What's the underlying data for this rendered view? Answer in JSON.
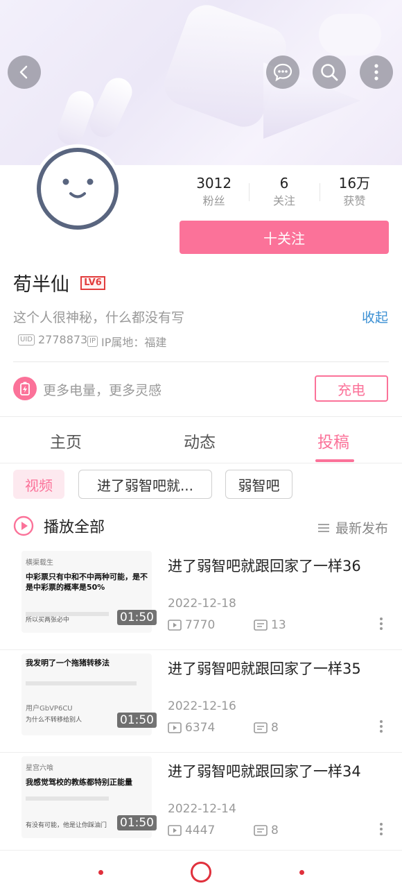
{
  "profile": {
    "name": "荀半仙",
    "level": "LV6",
    "bio": "这个人很神秘，什么都没有写",
    "collapse_label": "收起",
    "uid_badge": "UID",
    "uid": "2778873",
    "ip_badge": "IP",
    "ip_location": "IP属地：福建"
  },
  "stats": [
    {
      "value": "3012",
      "label": "粉丝"
    },
    {
      "value": "6",
      "label": "关注"
    },
    {
      "value": "16万",
      "label": "获赞"
    }
  ],
  "follow_label": "十关注",
  "charge": {
    "text": "更多电量，更多灵感",
    "button": "充电"
  },
  "tabs": [
    "主页",
    "动态",
    "投稿"
  ],
  "filters": [
    "视频",
    "进了弱智吧就...",
    "弱智吧"
  ],
  "play_all_label": "播放全部",
  "sort_label": "最新发布",
  "videos": [
    {
      "title": "进了弱智吧就跟回家了一样36",
      "date": "2022-12-18",
      "plays": "7770",
      "comments": "13",
      "duration": "01:50",
      "thumb_user": "横渠载生",
      "thumb_text": "中彩票只有中和不中两种可能，是不是中彩票的概率是50%",
      "thumb_sub": "所以买两张必中"
    },
    {
      "title": "进了弱智吧就跟回家了一样35",
      "date": "2022-12-16",
      "plays": "6374",
      "comments": "8",
      "duration": "01:50",
      "thumb_user": "用户GbVP6CU",
      "thumb_text": "我发明了一个拖猪转移法",
      "thumb_sub": "为什么不转移给别人"
    },
    {
      "title": "进了弱智吧就跟回家了一样34",
      "date": "2022-12-14",
      "plays": "4447",
      "comments": "8",
      "duration": "01:50",
      "thumb_user": "星宫六喰",
      "thumb_text": "我感觉驾校的教练都特别正能量",
      "thumb_sub": "有没有可能，他是让你踩油门"
    }
  ],
  "colors": {
    "accent": "#fb7299",
    "link": "#3a8fd3",
    "nav_red": "#e0303c"
  }
}
